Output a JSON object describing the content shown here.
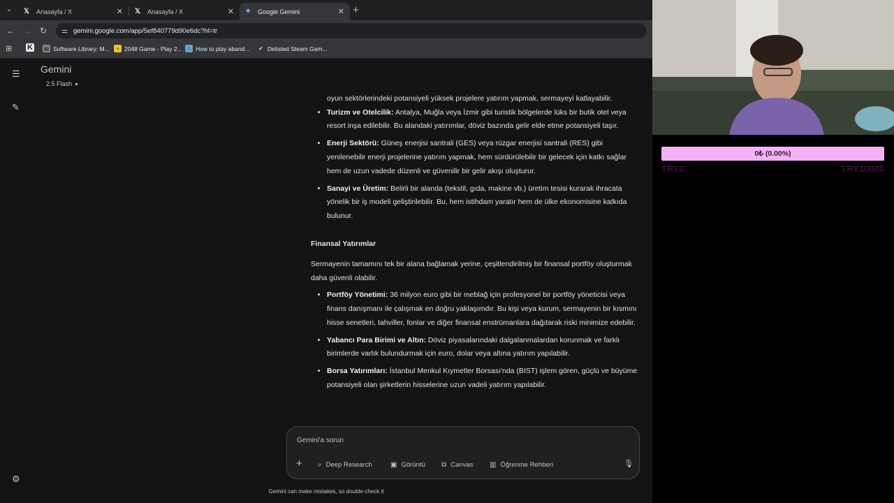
{
  "browser": {
    "tabs": [
      {
        "label": "Anasayfa / X",
        "icon": "x-logo-icon",
        "active": false
      },
      {
        "label": "Anasayfa / X",
        "icon": "x-logo-icon",
        "active": false
      },
      {
        "label": "Google Gemini",
        "icon": "gemini-star-icon",
        "active": true
      }
    ],
    "url": "gemini.google.com/app/5ef840779d90e6dc?hl=tr",
    "bookmarks": [
      {
        "label": "Software Library: M...",
        "icon": "archive-icon"
      },
      {
        "label": "2048 Game - Play 2...",
        "icon": "game-tile-icon"
      },
      {
        "label": "How to play aband...",
        "icon": "page-icon"
      },
      {
        "label": "Delisted Steam Gam...",
        "icon": "steam-icon"
      }
    ]
  },
  "gemini": {
    "title": "Gemini",
    "model": "2.5 Flash",
    "content": {
      "intro_tail": "oyun sektörlerindeki potansiyeli yüksek projelere yatırım yapmak, sermayeyi katlayabilir.",
      "bullets_a": [
        {
          "title": "Turizm ve Otelcilik:",
          "text": " Antalya, Muğla veya İzmir gibi turistik bölgelerde lüks bir butik otel veya resort inşa edilebilir. Bu alandaki yatırımlar, döviz bazında gelir elde etme potansiyeli taşır."
        },
        {
          "title": "Enerji Sektörü:",
          "text": " Güneş enerjisi santrali (GES) veya rüzgar enerjisi santrali (RES) gibi yenilenebilir enerji projelerine yatırım yapmak, hem sürdürülebilir bir gelecek için katkı sağlar hem de uzun vadede düzenli ve güvenilir bir gelir akışı oluşturur."
        },
        {
          "title": "Sanayi ve Üretim:",
          "text": " Belirli bir alanda (tekstil, gıda, makine vb.) üretim tesisi kurarak ihracata yönelik bir iş modeli geliştirilebilir. Bu, hem istihdam yaratır hem de ülke ekonomisine katkıda bulunur."
        }
      ],
      "heading": "Finansal Yatırımlar",
      "paragraph": "Sermayenin tamamını tek bir alana bağlamak yerine, çeşitlendirilmiş bir finansal portföy oluşturmak daha güvenli olabilir.",
      "bullets_b": [
        {
          "title": "Portföy Yönetimi:",
          "text": " 36 milyon euro gibi bir meblağ için profesyonel bir portföy yöneticisi veya finans danışmanı ile çalışmak en doğru yaklaşımdır. Bu kişi veya kurum, sermayenin bir kısmını hisse senetleri, tahviller, fonlar ve diğer finansal enstrümanlara dağıtarak riski minimize edebilir."
        },
        {
          "title": "Yabancı Para Birimi ve Altın:",
          "text": " Döviz piyasalarındaki dalgalanmalardan korunmak ve farklı birimlerde varlık bulundurmak için euro, dolar veya altına yatırım yapılabilir."
        },
        {
          "title": "Borsa Yatırımları:",
          "text": " İstanbul Menkul Kıymetler Borsası'nda (BIST) işlem gören, güçlü ve büyüme potansiyeli olan şirketlerin hisselerine uzun vadeli yatırım yapılabilir."
        }
      ]
    },
    "composer": {
      "placeholder": "Gemini'a sorun",
      "tools": [
        {
          "label": "Deep Research",
          "icon": "deep-research-icon"
        },
        {
          "label": "Görüntü",
          "icon": "image-icon"
        },
        {
          "label": "Canvas",
          "icon": "canvas-icon"
        },
        {
          "label": "Öğrenme Rehberi",
          "icon": "book-icon"
        }
      ]
    },
    "disclaimer": "Gemini can make mistakes, so double-check it"
  },
  "stream_overlay": {
    "goal_text": "0₺ (0.00%)",
    "goal_progress": 0.0,
    "min_label": "TRY0",
    "max_label": "TRY10000",
    "accent_color": "#f7b1f7"
  }
}
